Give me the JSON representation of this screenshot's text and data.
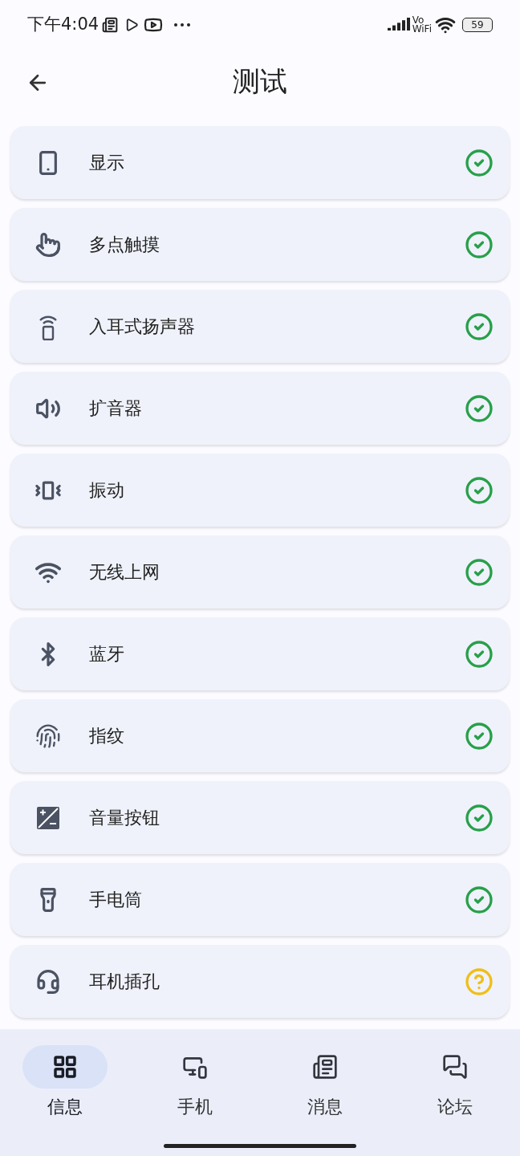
{
  "status_bar": {
    "time": "下午4:04",
    "network_top": "Vo",
    "network_bottom": "WiFi",
    "battery": "59"
  },
  "header": {
    "title": "测试"
  },
  "tests": [
    {
      "label": "显示",
      "passed": true
    },
    {
      "label": "多点触摸",
      "passed": true
    },
    {
      "label": "入耳式扬声器",
      "passed": true
    },
    {
      "label": "扩音器",
      "passed": true
    },
    {
      "label": "振动",
      "passed": true
    },
    {
      "label": "无线上网",
      "passed": true
    },
    {
      "label": "蓝牙",
      "passed": true
    },
    {
      "label": "指纹",
      "passed": true
    },
    {
      "label": "音量按钮",
      "passed": true
    },
    {
      "label": "手电筒",
      "passed": true
    },
    {
      "label": "耳机插孔",
      "passed": false
    }
  ],
  "bottom_nav": [
    {
      "label": "信息",
      "selected": true
    },
    {
      "label": "手机",
      "selected": false
    },
    {
      "label": "消息",
      "selected": false
    },
    {
      "label": "论坛",
      "selected": false
    }
  ]
}
